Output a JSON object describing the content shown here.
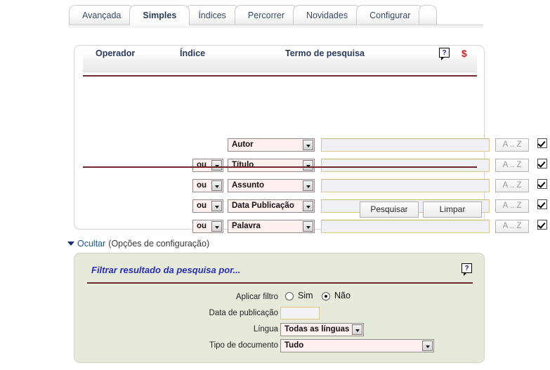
{
  "tabs": [
    {
      "label": "Avançada",
      "active": false
    },
    {
      "label": "Simples",
      "active": true
    },
    {
      "label": "Índices",
      "active": false
    },
    {
      "label": "Percorrer",
      "active": false
    },
    {
      "label": "Novidades",
      "active": false
    },
    {
      "label": "Configurar",
      "active": false
    }
  ],
  "search_panel": {
    "headers": {
      "operador": "Operador",
      "indice": "Índice",
      "termo": "Termo de pesquisa",
      "help_icon": "help-question-icon",
      "help_glyph": "?",
      "dollar_icon": "dollar-icon",
      "dollar_glyph": "$"
    },
    "rows": [
      {
        "operator": "",
        "index": "Autor",
        "term": "",
        "az_label": "A .. Z",
        "checked": true
      },
      {
        "operator": "ou",
        "index": "Título",
        "term": "",
        "az_label": "A .. Z",
        "checked": true
      },
      {
        "operator": "ou",
        "index": "Assunto",
        "term": "",
        "az_label": "A .. Z",
        "checked": true
      },
      {
        "operator": "ou",
        "index": "Data Publicação",
        "term": "",
        "az_label": "A .. Z",
        "checked": true
      },
      {
        "operator": "ou",
        "index": "Palavra",
        "term": "",
        "az_label": "A .. Z",
        "checked": true
      }
    ],
    "buttons": {
      "search": "Pesquisar",
      "clear": "Limpar"
    }
  },
  "toggle": {
    "triangle_icon": "triangle-down-icon",
    "link": "Ocultar",
    "note": "(Opções de configuração)"
  },
  "filter_panel": {
    "title": "Filtrar resultado da pesquisa por...",
    "help_icon": "help-question-icon",
    "help_glyph": "?",
    "apply": {
      "label": "Aplicar filtro",
      "yes": "Sim",
      "no": "Não",
      "selected": "Não"
    },
    "date": {
      "label": "Data de publicação",
      "value": ""
    },
    "language": {
      "label": "Língua",
      "value": "Todas as línguas"
    },
    "doctype": {
      "label": "Tipo de documento",
      "value": "Tudo"
    }
  },
  "colors": {
    "accent_rule": "#6e2a2a",
    "filter_bg": "#e5eadb",
    "title_blue": "#2b2bbb",
    "dollar_red": "#cc2222",
    "select_bg": "#fdf0ee",
    "input_border": "#dcc88a"
  }
}
